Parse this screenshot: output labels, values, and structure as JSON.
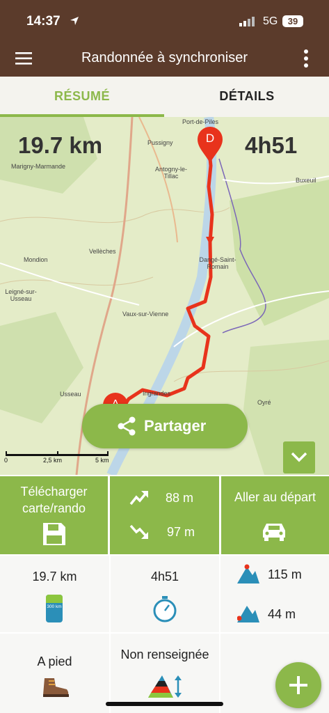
{
  "status": {
    "time": "14:37",
    "network": "5G",
    "battery": "39"
  },
  "header": {
    "title": "Randonnée à synchroniser"
  },
  "tabs": [
    {
      "label": "RÉSUMÉ"
    },
    {
      "label": "DÉTAILS"
    }
  ],
  "map": {
    "distance": "19.7 km",
    "duration": "4h51",
    "start_marker": "A",
    "end_marker": "D",
    "places": [
      "Port-de-Piles",
      "Pussigny",
      "Marigny-Marmande",
      "Antogny-le-Tillac",
      "Buxeuil",
      "Vellèches",
      "Mondion",
      "Dangé-Saint-Romain",
      "Leigné-sur-Usseau",
      "Vaux-sur-Vienne",
      "Usseau",
      "Ingrandes",
      "Oyré"
    ],
    "scale": [
      "0",
      "2,5 km",
      "5 km"
    ],
    "share_label": "Partager"
  },
  "actions": {
    "download_label": "Télécharger carte/rando",
    "ascent": "88 m",
    "descent": "97 m",
    "go_start_label": "Aller au départ"
  },
  "stats": {
    "distance": "19.7 km",
    "distance_badge": "300 km",
    "duration": "4h51",
    "max_altitude": "115 m",
    "min_altitude": "44 m",
    "activity": "A pied",
    "difficulty": "Non renseignée"
  },
  "colors": {
    "brand_brown": "#5b3b2b",
    "accent_green": "#8cb84a",
    "route_red": "#e8331c"
  }
}
